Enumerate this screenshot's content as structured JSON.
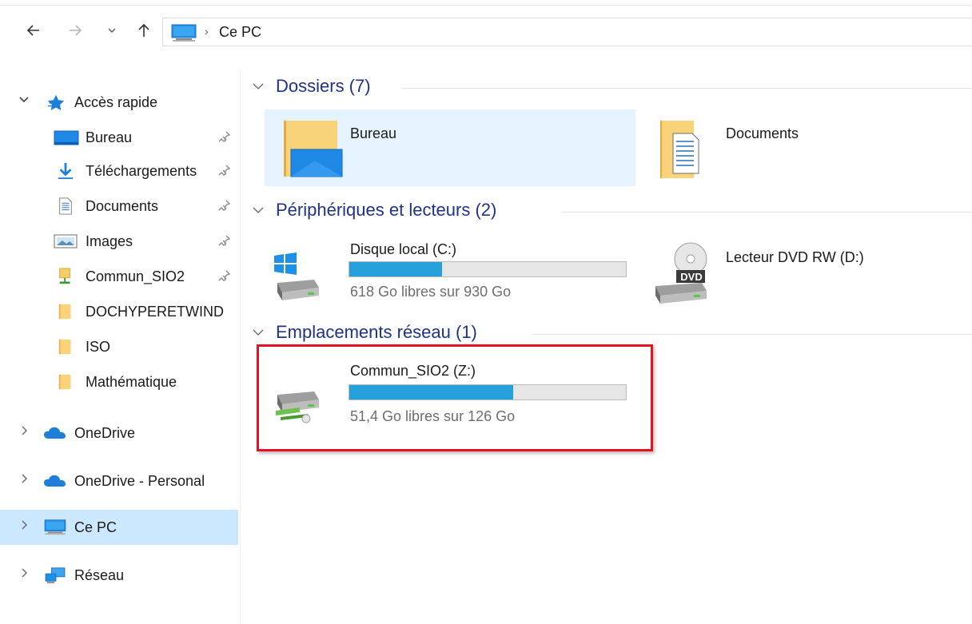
{
  "nav": {
    "back_icon": "arrow-left-icon",
    "forward_icon": "arrow-right-icon",
    "recent_icon": "chevron-down-icon",
    "up_icon": "arrow-up-icon"
  },
  "address": {
    "icon": "computer-icon",
    "location": "Ce PC"
  },
  "sidebar": {
    "quick_access": {
      "label": "Accès rapide",
      "items": [
        {
          "label": "Bureau",
          "icon": "desktop-folder-icon",
          "pinned": true
        },
        {
          "label": "Téléchargements",
          "icon": "download-arrow-icon",
          "pinned": true
        },
        {
          "label": "Documents",
          "icon": "document-icon",
          "pinned": true
        },
        {
          "label": "Images",
          "icon": "image-icon",
          "pinned": true
        },
        {
          "label": "Commun_SIO2",
          "icon": "network-drive-icon",
          "pinned": true
        },
        {
          "label": "DOCHYPERETWIND",
          "icon": "folder-icon",
          "pinned": false
        },
        {
          "label": "ISO",
          "icon": "folder-icon",
          "pinned": false
        },
        {
          "label": "Mathématique",
          "icon": "folder-icon",
          "pinned": false
        }
      ]
    },
    "roots": [
      {
        "label": "OneDrive",
        "icon": "cloud-icon"
      },
      {
        "label": "OneDrive - Personal",
        "icon": "cloud-icon"
      },
      {
        "label": "Ce PC",
        "icon": "computer-icon",
        "selected": true
      },
      {
        "label": "Réseau",
        "icon": "network-icon"
      }
    ]
  },
  "main": {
    "sections": {
      "folders": {
        "title": "Dossiers (7)"
      },
      "devices": {
        "title": "Périphériques et lecteurs (2)"
      },
      "network": {
        "title": "Emplacements réseau (1)"
      }
    },
    "folders": [
      {
        "name": "Bureau",
        "icon": "desktop-folder-icon",
        "selected": true
      },
      {
        "name": "Documents",
        "icon": "documents-folder-icon"
      }
    ],
    "drives": [
      {
        "name": "Disque local (C:)",
        "free_text": "618 Go libres sur 930 Go",
        "used_fraction": 0.335,
        "icon": "windows-drive-icon"
      },
      {
        "name": "Lecteur DVD RW (D:)",
        "icon": "dvd-drive-icon",
        "badge": "DVD"
      }
    ],
    "network_locations": [
      {
        "name": "Commun_SIO2 (Z:)",
        "free_text": "51,4 Go libres sur 126 Go",
        "used_fraction": 0.592,
        "icon": "network-drive-icon"
      }
    ]
  },
  "colors": {
    "accent_bar": "#26a0da",
    "section_title": "#1e3287",
    "selection": "#cce8ff",
    "highlight_border": "#e81123"
  }
}
